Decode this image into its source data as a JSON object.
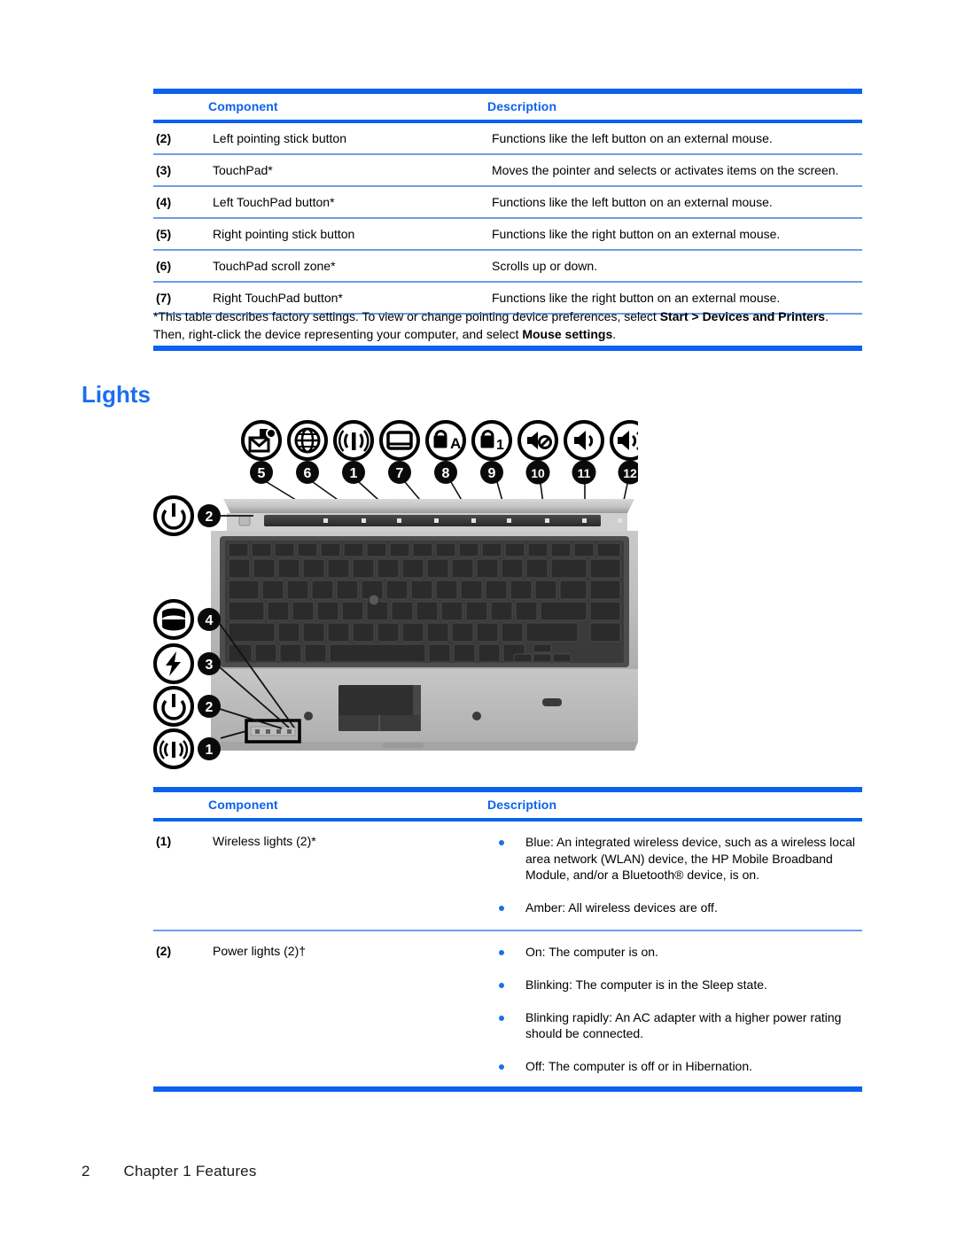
{
  "table_top": {
    "headers": {
      "component": "Component",
      "description": "Description"
    },
    "rows": [
      {
        "num": "(2)",
        "component": "Left pointing stick button",
        "description": "Functions like the left button on an external mouse."
      },
      {
        "num": "(3)",
        "component": "TouchPad*",
        "description": "Moves the pointer and selects or activates items on the screen."
      },
      {
        "num": "(4)",
        "component": "Left TouchPad button*",
        "description": "Functions like the left button on an external mouse."
      },
      {
        "num": "(5)",
        "component": "Right pointing stick button",
        "description": "Functions like the right button on an external mouse."
      },
      {
        "num": "(6)",
        "component": "TouchPad scroll zone*",
        "description": "Scrolls up or down."
      },
      {
        "num": "(7)",
        "component": "Right TouchPad button*",
        "description": "Functions like the right button on an external mouse."
      }
    ],
    "footnote": {
      "line1_a": "*This table describes factory settings. To view or change pointing device preferences, select ",
      "line1_bold": "Start > Devices and Printers",
      "line1_b": ".",
      "line2_a": "Then, right-click the device representing your computer, and select ",
      "line2_bold": "Mouse settings",
      "line2_b": "."
    }
  },
  "section": {
    "heading": "Lights"
  },
  "figure": {
    "alt": "HP EliteBook laptop top view with numbered light callouts",
    "icon_row": [
      {
        "callout": "5",
        "icon": "mail-icon"
      },
      {
        "callout": "6",
        "icon": "globe-icon"
      },
      {
        "callout": "1",
        "icon": "wireless-icon"
      },
      {
        "callout": "7",
        "icon": "touchpad-icon"
      },
      {
        "callout": "8",
        "icon": "caps-lock-icon"
      },
      {
        "callout": "9",
        "icon": "num-lock-icon"
      },
      {
        "callout": "10",
        "icon": "volume-mute-icon"
      },
      {
        "callout": "11",
        "icon": "volume-down-icon"
      },
      {
        "callout": "12",
        "icon": "volume-up-icon"
      }
    ],
    "left_icons": [
      {
        "callout": "2",
        "icon": "power-icon"
      },
      {
        "callout": "4",
        "icon": "drive-icon"
      },
      {
        "callout": "3",
        "icon": "battery-icon"
      },
      {
        "callout": "2",
        "icon": "power-icon"
      },
      {
        "callout": "1",
        "icon": "wireless-icon"
      }
    ]
  },
  "table_bottom": {
    "headers": {
      "component": "Component",
      "description": "Description"
    },
    "rows": [
      {
        "num": "(1)",
        "component": "Wireless lights (2)*",
        "bullets": [
          "Blue: An integrated wireless device, such as a wireless local area network (WLAN) device, the HP Mobile Broadband Module, and/or a Bluetooth® device, is on.",
          "Amber: All wireless devices are off."
        ]
      },
      {
        "num": "(2)",
        "component": "Power lights (2)†",
        "bullets": [
          "On: The computer is on.",
          "Blinking: The computer is in the Sleep state.",
          "Blinking rapidly: An AC adapter with a higher power rating should be connected.",
          "Off: The computer is off or in Hibernation."
        ]
      }
    ]
  },
  "footer": {
    "page_number": "2",
    "chapter": "Chapter 1   Features"
  },
  "colors": {
    "accent_blue": "#0b62ef",
    "heading_blue": "#1a6ff0",
    "rule_light": "#6c9ded"
  }
}
